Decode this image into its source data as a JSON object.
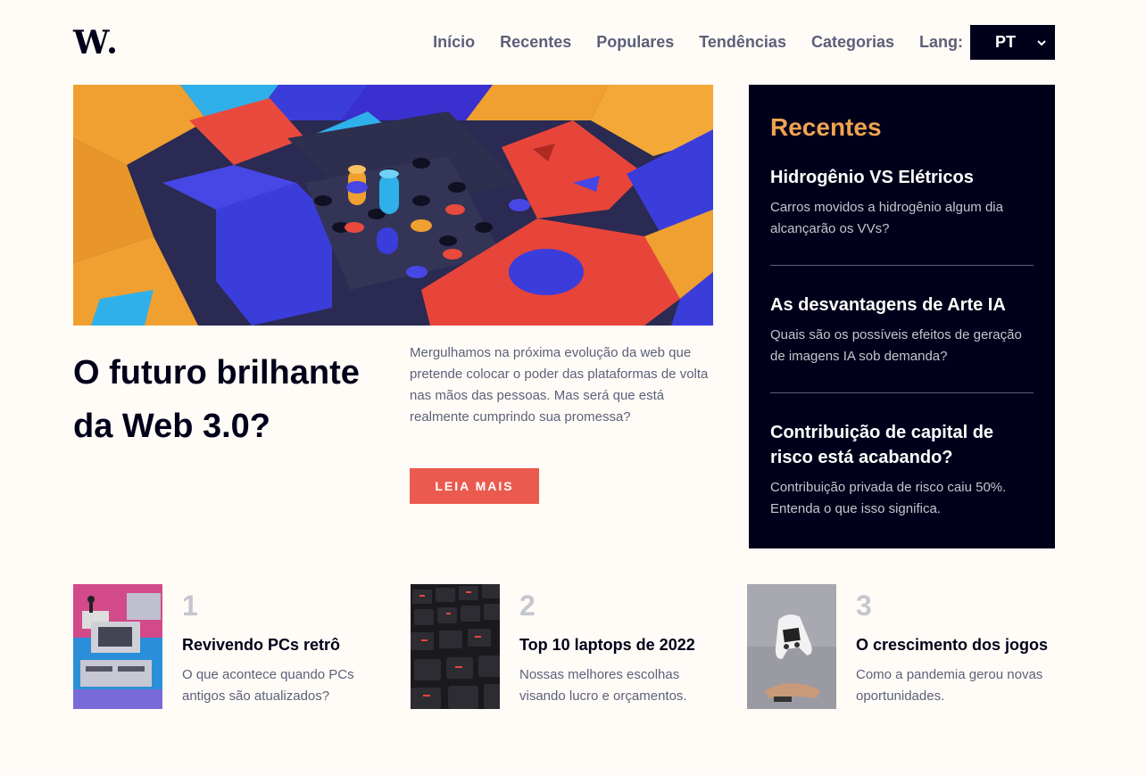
{
  "header": {
    "logo": "W",
    "nav": [
      "Início",
      "Recentes",
      "Populares",
      "Tendências",
      "Categorias"
    ],
    "lang_label": "Lang:",
    "lang_value": "PT"
  },
  "hero": {
    "title": "O futuro brilhante da Web 3.0?",
    "description": "Mergulhamos na próxima evolução da web que pretende colocar o poder das plataformas de volta nas mãos das pessoas. Mas será que está realmente cumprindo sua promessa?",
    "button": "LEIA MAIS"
  },
  "sidebar": {
    "title": "Recentes",
    "items": [
      {
        "title": "Hidrogênio VS Elétricos",
        "text": "Carros movidos a hidrogênio algum dia alcançarão os VVs?"
      },
      {
        "title": "As desvantagens de Arte IA",
        "text": "Quais são os possíveis efeitos de geração de imagens IA sob demanda?"
      },
      {
        "title": "Contribuição de capital de risco está acabando?",
        "text": "Contribuição privada de risco caiu 50%. Entenda o que isso significa."
      }
    ]
  },
  "cards": [
    {
      "num": "1",
      "title": "Revivendo PCs retrô",
      "text": "O que acontece quando PCs antigos são atualizados?"
    },
    {
      "num": "2",
      "title": "Top 10 laptops de 2022",
      "text": "Nossas melhores escolhas visando lucro e orçamentos."
    },
    {
      "num": "3",
      "title": "O crescimento dos jogos",
      "text": "Como a pandemia gerou novas oportunidades."
    }
  ]
}
